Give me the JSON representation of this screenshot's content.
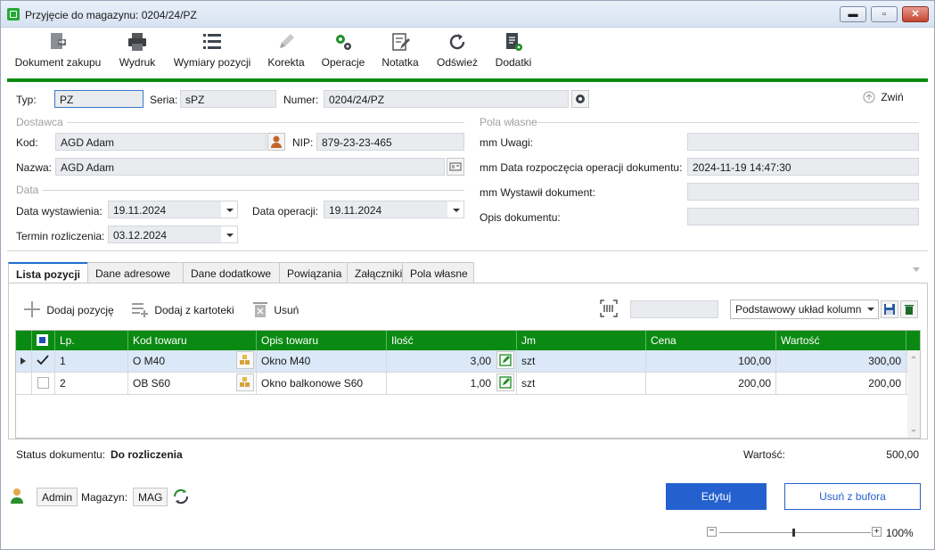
{
  "window": {
    "title": "Przyjęcie do magazynu: 0204/24/PZ",
    "minimize": "▬",
    "restore": "▫",
    "close": "✕"
  },
  "toolbar": {
    "items": [
      {
        "label": "Dokument zakupu",
        "icon": "purchase-document-icon"
      },
      {
        "label": "Wydruk",
        "icon": "printer-icon"
      },
      {
        "label": "Wymiary pozycji",
        "icon": "list-icon"
      },
      {
        "label": "Korekta",
        "icon": "pencil-icon"
      },
      {
        "label": "Operacje",
        "icon": "gears-icon"
      },
      {
        "label": "Notatka",
        "icon": "note-icon"
      },
      {
        "label": "Odśwież",
        "icon": "refresh-icon"
      },
      {
        "label": "Dodatki",
        "icon": "addons-icon"
      }
    ]
  },
  "header": {
    "typ_label": "Typ:",
    "typ_value": "PZ",
    "seria_label": "Seria:",
    "seria_value": "sPZ",
    "numer_label": "Numer:",
    "numer_value": "0204/24/PZ",
    "collapse_label": "Zwiń"
  },
  "dostawca": {
    "section": "Dostawca",
    "kod_label": "Kod:",
    "kod_value": "AGD Adam",
    "nip_label": "NIP:",
    "nip_value": "879-23-23-465",
    "nazwa_label": "Nazwa:",
    "nazwa_value": "AGD Adam"
  },
  "data": {
    "section": "Data",
    "wystawienia_label": "Data wystawienia:",
    "wystawienia_value": "19.11.2024",
    "operacji_label": "Data operacji:",
    "operacji_value": "19.11.2024",
    "termin_label": "Termin rozliczenia:",
    "termin_value": "03.12.2024"
  },
  "pola_wlasne": {
    "section": "Pola własne",
    "items": [
      {
        "label": "mm Uwagi:",
        "value": ""
      },
      {
        "label": "mm Data rozpoczęcia operacji dokumentu:",
        "value": "2024-11-19 14:47:30"
      },
      {
        "label": "mm Wystawił dokument:",
        "value": ""
      },
      {
        "label": "Opis dokumentu:",
        "value": ""
      }
    ]
  },
  "tabs": [
    "Lista pozycji",
    "Dane adresowe",
    "Dane dodatkowe",
    "Powiązania",
    "Załączniki",
    "Pola własne"
  ],
  "positions_toolbar": {
    "add": "Dodaj pozycję",
    "add_from_catalog": "Dodaj z kartoteki",
    "delete": "Usuń",
    "layout_value": "Podstawowy układ kolumn"
  },
  "grid": {
    "columns": [
      "Lp.",
      "Kod towaru",
      "Opis towaru",
      "Ilość",
      "Jm",
      "Cena",
      "Wartość"
    ],
    "rows": [
      {
        "lp": "1",
        "kod": "O M40",
        "opis": "Okno M40",
        "ilosc": "3,00",
        "jm": "szt",
        "cena": "100,00",
        "wartosc": "300,00",
        "checked": true,
        "current": true
      },
      {
        "lp": "2",
        "kod": "OB S60",
        "opis": "Okno balkonowe S60",
        "ilosc": "1,00",
        "jm": "szt",
        "cena": "200,00",
        "wartosc": "200,00",
        "checked": false,
        "current": false
      }
    ]
  },
  "footer": {
    "status_label": "Status dokumentu:",
    "status_value": "Do rozliczenia",
    "wartosc_label": "Wartość:",
    "wartosc_value": "500,00",
    "user": "Admin",
    "magazyn_label": "Magazyn:",
    "magazyn_value": "MAG",
    "edit_button": "Edytuj",
    "remove_button": "Usuń z bufora",
    "zoom": "100%"
  },
  "colors": {
    "accent_green": "#0a8a12",
    "primary_blue": "#2461cf"
  }
}
